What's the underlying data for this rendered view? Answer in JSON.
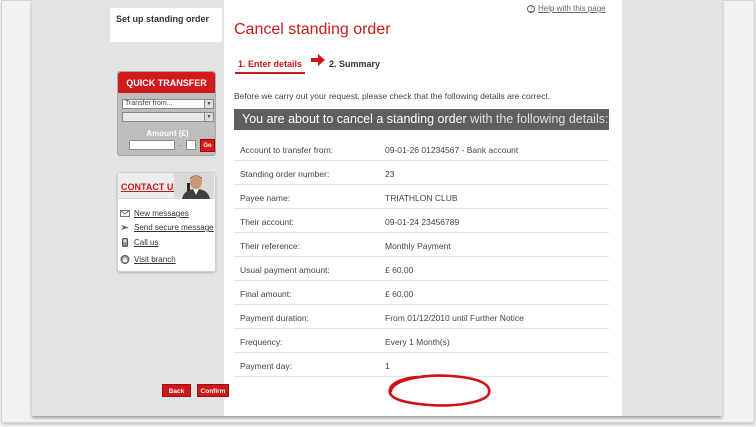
{
  "sidebar": {
    "current_item": "Set up standing order",
    "quick_transfer": {
      "title": "QUICK TRANSFER",
      "from_select": "Transfer from...",
      "to_select": "",
      "amount_label": "Amount (£)",
      "decimal_point": ".",
      "go_label": "Go"
    },
    "contact": {
      "title": "CONTACT US",
      "links": [
        {
          "label": "New messages",
          "icon": "envelope-icon"
        },
        {
          "label": "Send secure message",
          "icon": "send-message-icon"
        },
        {
          "label": "Call us",
          "icon": "phone-icon"
        },
        {
          "label": "Visit branch",
          "icon": "branch-icon"
        }
      ]
    }
  },
  "main": {
    "help_link": "Help with this page",
    "title": "Cancel standing order",
    "steps": [
      "1. Enter details",
      "2. Summary"
    ],
    "intro": "Before we carry out your request, please check that the following details are correct.",
    "banner_strong": "You are about to cancel a standing order",
    "banner_rest": " with the following details:",
    "details": [
      {
        "label": "Account to transfer from:",
        "value": "09-01-26 01234567 - Bank account"
      },
      {
        "label": "Standing order number:",
        "value": "23"
      },
      {
        "label": "Payee name:",
        "value": "TRIATHLON CLUB"
      },
      {
        "label": "Their account:",
        "value": "09-01-24 23456789"
      },
      {
        "label": "Their reference:",
        "value": "Monthly Payment"
      },
      {
        "label": "Usual payment amount:",
        "value": "£ 60.00"
      },
      {
        "label": "Final amount:",
        "value": "£ 60.00"
      },
      {
        "label": "Payment duration:",
        "value": "From 01/12/2010 until Further Notice"
      },
      {
        "label": "Frequency:",
        "value": "Every 1 Month(s)"
      },
      {
        "label": "Payment day:",
        "value": "1"
      }
    ],
    "buttons": {
      "back": "Back",
      "confirm": "Confirm"
    }
  },
  "colors": {
    "brand_red": "#cc1818",
    "banner_grey": "#5f5f5f",
    "annotation_red": "#d0101a"
  }
}
